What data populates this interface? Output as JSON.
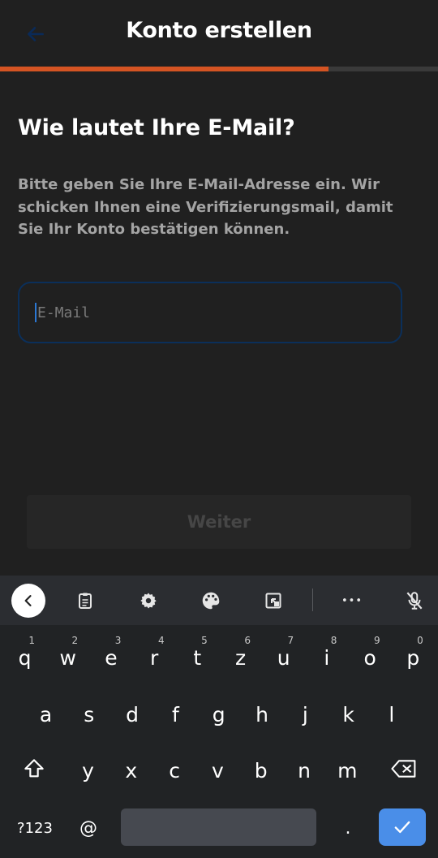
{
  "appbar": {
    "title": "Konto erstellen",
    "back_icon": "arrow-left-icon"
  },
  "progress": {
    "fraction": 0.75,
    "color": "#d45423"
  },
  "page": {
    "heading": "Wie lautet Ihre E-Mail?",
    "description": "Bitte geben Sie Ihre E-Mail-Adresse ein. Wir schicken Ihnen eine Verifizierungsmail, damit Sie Ihr Konto bestätigen können.",
    "email_placeholder": "E-Mail",
    "email_value": "",
    "continue_label": "Weiter"
  },
  "keyboard": {
    "toolbar_icons": [
      "chevron-left-icon",
      "clipboard-icon",
      "gear-icon",
      "palette-icon",
      "resize-icon",
      "more-icon",
      "mic-off-icon"
    ],
    "more_label": "•••",
    "row1": [
      {
        "ch": "q",
        "hint": "1"
      },
      {
        "ch": "w",
        "hint": "2"
      },
      {
        "ch": "e",
        "hint": "3"
      },
      {
        "ch": "r",
        "hint": "4"
      },
      {
        "ch": "t",
        "hint": "5"
      },
      {
        "ch": "z",
        "hint": "6"
      },
      {
        "ch": "u",
        "hint": "7"
      },
      {
        "ch": "i",
        "hint": "8"
      },
      {
        "ch": "o",
        "hint": "9"
      },
      {
        "ch": "p",
        "hint": "0"
      }
    ],
    "row2": [
      "a",
      "s",
      "d",
      "f",
      "g",
      "h",
      "j",
      "k",
      "l"
    ],
    "row3": [
      "y",
      "x",
      "c",
      "v",
      "b",
      "n",
      "m"
    ],
    "symbols_label": "?123",
    "at_label": "@",
    "period_label": "."
  }
}
